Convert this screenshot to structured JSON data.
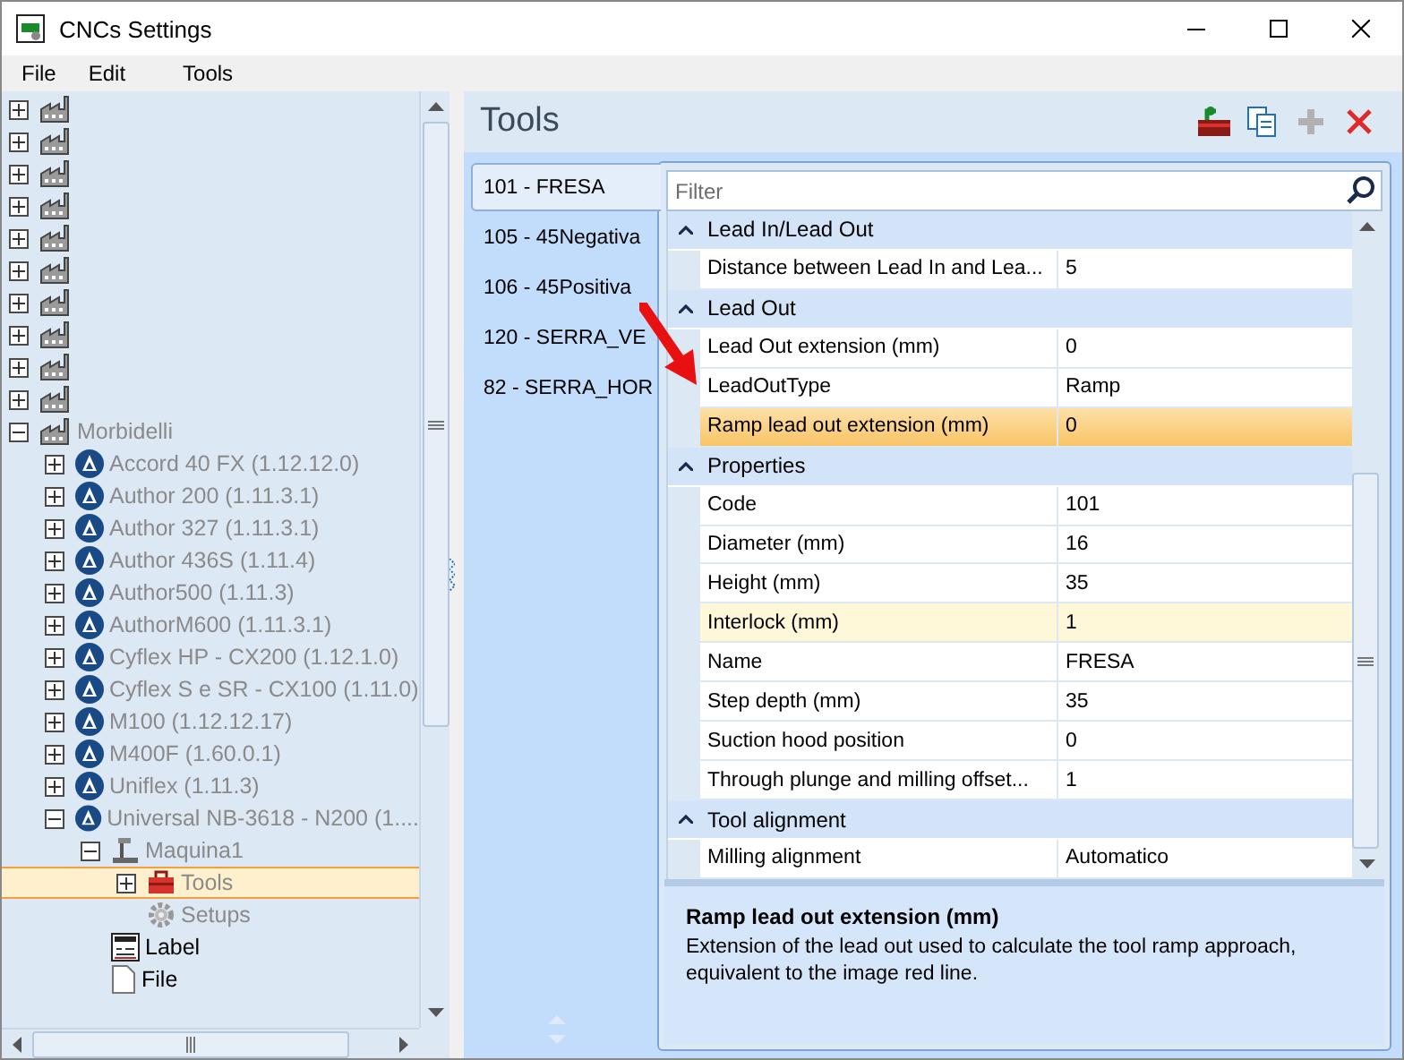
{
  "window": {
    "title": "CNCs Settings"
  },
  "menu": [
    "File",
    "Edit",
    "Tools"
  ],
  "tree": [
    {
      "kind": "factory",
      "expanded": false,
      "selected": false
    },
    {
      "kind": "factory",
      "expanded": false,
      "selected": false
    },
    {
      "kind": "factory",
      "expanded": false,
      "selected": false
    },
    {
      "kind": "factory",
      "expanded": false,
      "selected": false
    },
    {
      "kind": "factory",
      "expanded": false,
      "selected": false
    },
    {
      "kind": "factory",
      "expanded": false,
      "selected": false
    },
    {
      "kind": "factory",
      "expanded": false,
      "selected": false
    },
    {
      "kind": "factory",
      "expanded": false,
      "selected": false
    },
    {
      "kind": "factory",
      "expanded": false,
      "selected": false
    },
    {
      "kind": "factory",
      "expanded": false,
      "selected": false
    },
    {
      "kind": "factory",
      "label": "Morbidelli",
      "expanded": true,
      "selected": false,
      "dimmed": true,
      "children": [
        {
          "kind": "model",
          "label": "Accord 40 FX (1.12.12.0)",
          "expanded": false,
          "selected": false,
          "dimmed": true
        },
        {
          "kind": "model",
          "label": "Author 200 (1.11.3.1)",
          "expanded": false,
          "selected": false,
          "dimmed": true
        },
        {
          "kind": "model",
          "label": "Author 327 (1.11.3.1)",
          "expanded": false,
          "selected": false,
          "dimmed": true
        },
        {
          "kind": "model",
          "label": "Author 436S (1.11.4)",
          "expanded": false,
          "selected": false,
          "dimmed": true
        },
        {
          "kind": "model",
          "label": "Author500 (1.11.3)",
          "expanded": false,
          "selected": false,
          "dimmed": true
        },
        {
          "kind": "model",
          "label": "AuthorM600 (1.11.3.1)",
          "expanded": false,
          "selected": false,
          "dimmed": true
        },
        {
          "kind": "model",
          "label": "Cyflex HP - CX200 (1.12.1.0)",
          "expanded": false,
          "selected": false,
          "dimmed": true
        },
        {
          "kind": "model",
          "label": "Cyflex S e SR - CX100 (1.11.0)",
          "expanded": false,
          "selected": false,
          "dimmed": true
        },
        {
          "kind": "model",
          "label": "M100 (1.12.12.17)",
          "expanded": false,
          "selected": false,
          "dimmed": true
        },
        {
          "kind": "model",
          "label": "M400F (1.60.0.1)",
          "expanded": false,
          "selected": false,
          "dimmed": true
        },
        {
          "kind": "model",
          "label": "Uniflex (1.11.3)",
          "expanded": false,
          "selected": false,
          "dimmed": true
        },
        {
          "kind": "model",
          "label": "Universal NB-3618 - N200 (1....",
          "expanded": true,
          "selected": false,
          "dimmed": true,
          "children": [
            {
              "kind": "machine",
              "label": "Maquina1",
              "expanded": true,
              "selected": false,
              "dimmed": true,
              "children": [
                {
                  "kind": "tools",
                  "label": "Tools",
                  "expanded": false,
                  "selected": true,
                  "dimmed": true
                },
                {
                  "kind": "setups",
                  "label": "Setups",
                  "selected": false,
                  "dimmed": true
                }
              ]
            },
            {
              "kind": "label",
              "label": "Label",
              "selected": false,
              "dimmed": false
            },
            {
              "kind": "file",
              "label": "File",
              "selected": false,
              "dimmed": false
            }
          ]
        }
      ]
    }
  ],
  "panel": {
    "title": "Tools",
    "toolbar": [
      {
        "kind": "export",
        "disabled": false
      },
      {
        "kind": "copy",
        "disabled": false
      },
      {
        "kind": "add",
        "disabled": true
      },
      {
        "kind": "delete",
        "disabled": false
      }
    ]
  },
  "tool_tabs": [
    {
      "label": "101 - FRESA",
      "selected": true
    },
    {
      "label": "105 - 45Negativa",
      "selected": false
    },
    {
      "label": "106 - 45Positiva",
      "selected": false
    },
    {
      "label": "120 - SERRA_VE",
      "selected": false
    },
    {
      "label": "82 - SERRA_HOR",
      "selected": false
    }
  ],
  "filter": {
    "placeholder": "Filter"
  },
  "sections": [
    {
      "title": "Lead In/Lead Out",
      "expanded": true,
      "rows": [
        {
          "name": "Distance between Lead In and Lea...",
          "value": "5",
          "selected": false,
          "hovered": false
        }
      ]
    },
    {
      "title": "Lead Out",
      "expanded": true,
      "rows": [
        {
          "name": "Lead Out extension (mm)",
          "value": "0",
          "selected": false,
          "hovered": false
        },
        {
          "name": "LeadOutType",
          "value": "Ramp",
          "selected": false,
          "hovered": false
        },
        {
          "name": "Ramp lead out extension (mm)",
          "value": "0",
          "selected": true,
          "hovered": false
        }
      ]
    },
    {
      "title": "Properties",
      "expanded": true,
      "rows": [
        {
          "name": "Code",
          "value": "101",
          "selected": false,
          "hovered": false
        },
        {
          "name": "Diameter (mm)",
          "value": "16",
          "selected": false,
          "hovered": false
        },
        {
          "name": "Height (mm)",
          "value": "35",
          "selected": false,
          "hovered": false
        },
        {
          "name": "Interlock (mm)",
          "value": "1",
          "selected": false,
          "hovered": true
        },
        {
          "name": "Name",
          "value": "FRESA",
          "selected": false,
          "hovered": false
        },
        {
          "name": "Step depth (mm)",
          "value": "35",
          "selected": false,
          "hovered": false
        },
        {
          "name": "Suction hood position",
          "value": "0",
          "selected": false,
          "hovered": false
        },
        {
          "name": "Through plunge and milling offset...",
          "value": "1",
          "selected": false,
          "hovered": false
        }
      ]
    },
    {
      "title": "Tool alignment",
      "expanded": true,
      "rows": [
        {
          "name": "Milling alignment",
          "value": "Automatico",
          "selected": false,
          "hovered": false
        }
      ]
    }
  ],
  "description": {
    "title": "Ramp lead out extension (mm)",
    "text": "Extension of the lead out used to calculate the tool ramp approach, equivalent to the image red line."
  }
}
